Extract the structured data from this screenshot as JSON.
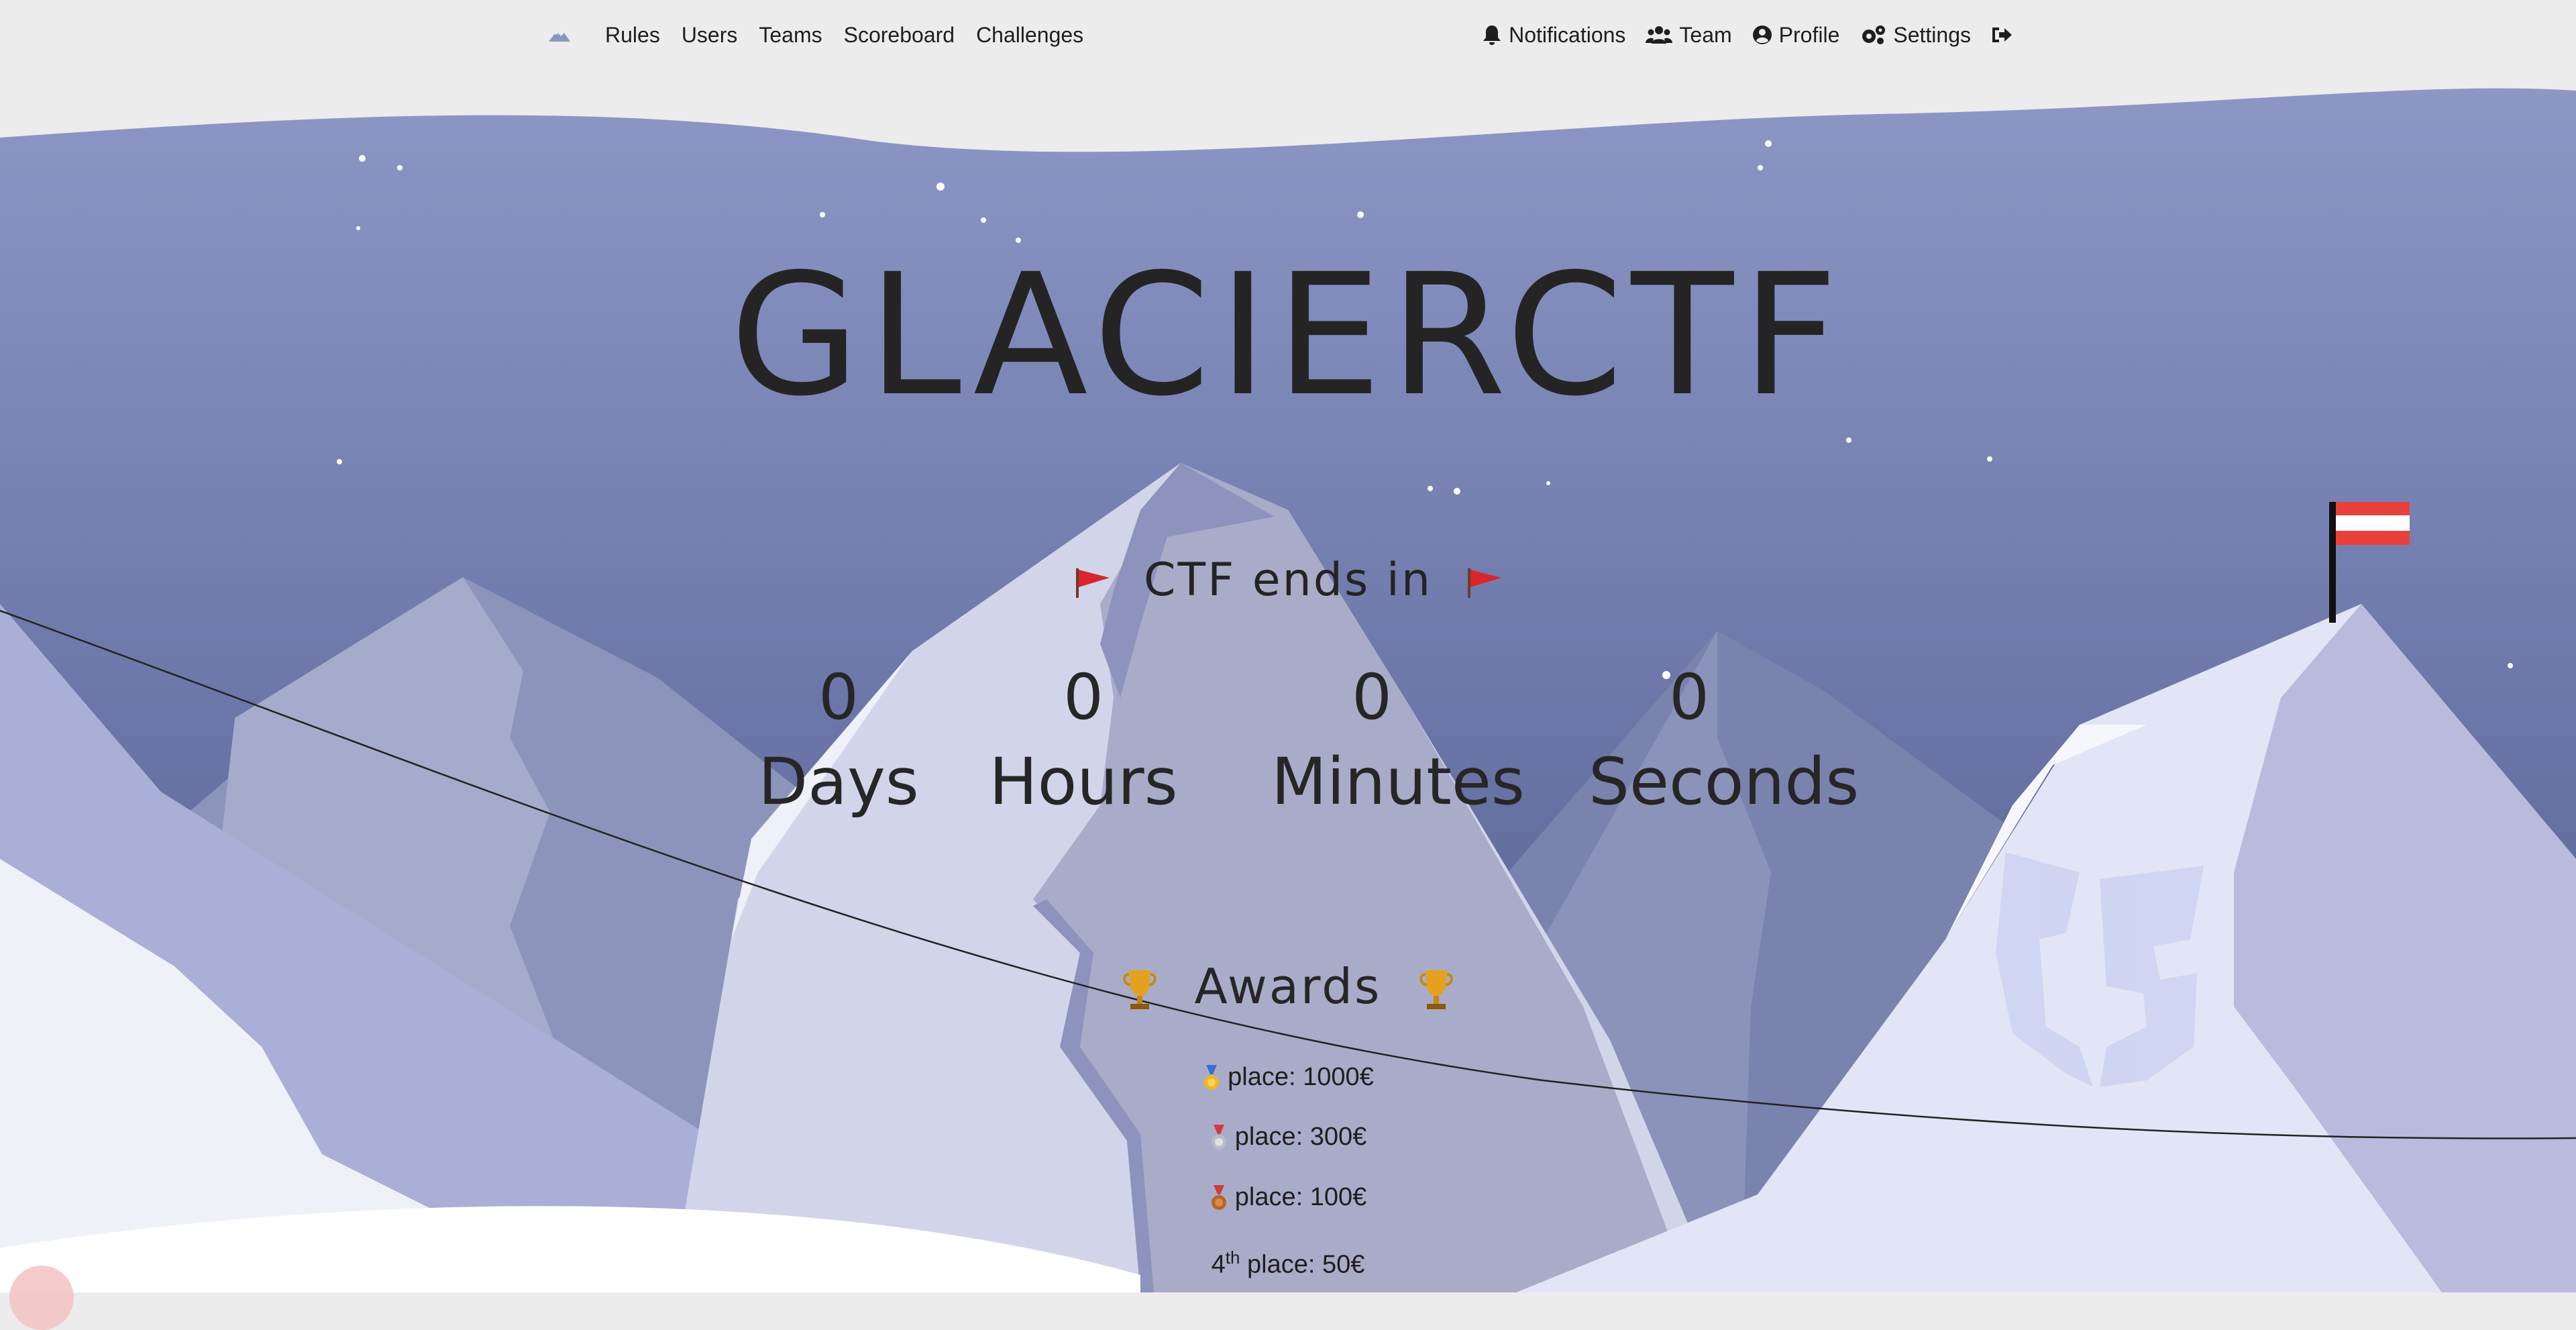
{
  "nav": {
    "left": [
      "Rules",
      "Users",
      "Teams",
      "Scoreboard",
      "Challenges"
    ],
    "notifications": "Notifications",
    "team": "Team",
    "profile": "Profile",
    "settings": "Settings"
  },
  "hero": {
    "title": "GLACIERCTF",
    "countdown_heading": "CTF ends in",
    "days": {
      "value": "0",
      "label": "Days"
    },
    "hours": {
      "value": "0",
      "label": "Hours"
    },
    "minutes": {
      "value": "0",
      "label": "Minutes"
    },
    "seconds": {
      "value": "0",
      "label": "Seconds"
    }
  },
  "awards": {
    "heading": "Awards",
    "first": "place: 1000€",
    "second": "place: 300€",
    "third": "place: 100€",
    "fourth_number": "4",
    "fourth_suffix": "th",
    "fourth": "place: 50€"
  },
  "colors": {
    "sky_top": "#8c97c6",
    "sky_bottom": "#5a6290",
    "navbar_bg": "#ececec",
    "austria_red": "#e8413c",
    "snow": "#ffffff"
  },
  "icons": [
    "mountain-logo-icon",
    "bell-icon",
    "users-icon",
    "user-circle-icon",
    "gears-icon",
    "sign-out-icon",
    "red-flag-icon",
    "trophy-icon",
    "gold-medal-icon",
    "silver-medal-icon",
    "bronze-medal-icon",
    "austria-flag-icon",
    "glacier-shield-watermark-icon"
  ]
}
